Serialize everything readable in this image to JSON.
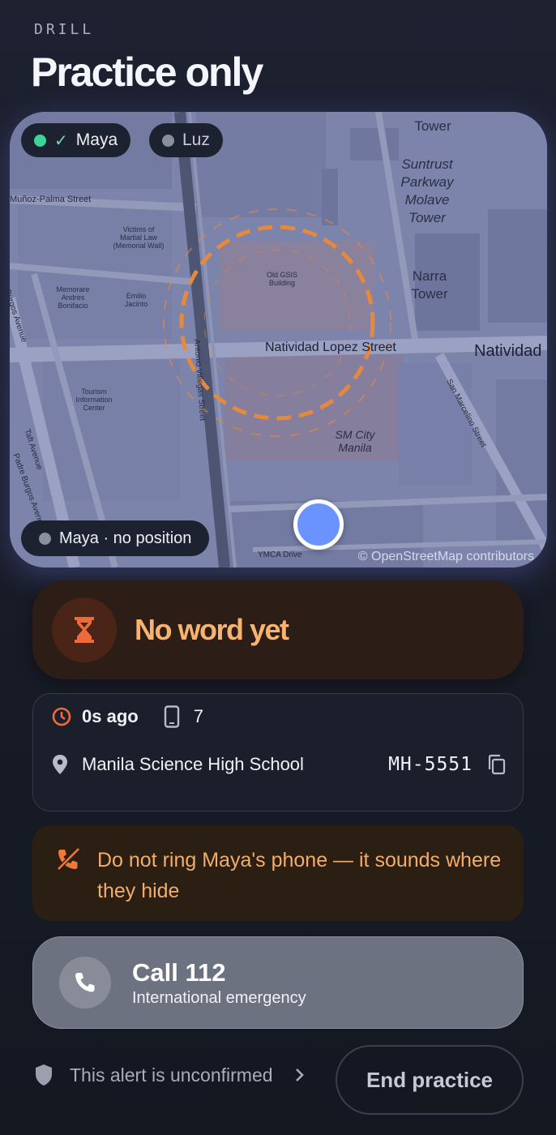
{
  "header": {
    "eyebrow": "DRILL",
    "title": "Practice only"
  },
  "map": {
    "chips": {
      "maya": {
        "label": "Maya",
        "dot_color": "#3fd39a",
        "confirmed": true
      },
      "luz": {
        "label": "Luz",
        "dot_color": "#8a8f9c"
      }
    },
    "no_position_label": "Maya · no position",
    "attribution": "© OpenStreetMap contributors",
    "labels": {
      "street1": "Natividad Lopez Street",
      "street2": "Natividad",
      "street3": "Muñoz-Palma Street",
      "street4": "Padre Burgos Avenue",
      "street5": "Taft Avenue",
      "street6": "Burgos Avenue",
      "street7": "San Marcelino Street",
      "street8": "Antonio Villegas Street",
      "street9": "YMCA Drive",
      "poi1": "Suntrust Parkway Molave Tower",
      "poi2": "Narra Tower",
      "poi3": "SM City Manila",
      "poi4": "Old GSIS Building",
      "poi5": "Victims of Martial Law (Memorial Wall)",
      "poi6": "Memorare Andres Bonifacio",
      "poi7": "Emilio Jacinto",
      "poi8": "Tourism Information Center",
      "poi9": "Tower"
    }
  },
  "status": {
    "text": "No word yet",
    "icon": "hourglass-icon",
    "color": "#f7b36f"
  },
  "info": {
    "time_ago": "0s ago",
    "device_count": "7",
    "location": "Manila Science High School",
    "code": "MH-5551"
  },
  "warning": {
    "text": "Do not ring Maya's phone — it sounds where they hide"
  },
  "call": {
    "title": "Call 112",
    "subtitle": "International emergency"
  },
  "footer": {
    "unconfirmed": "This alert is unconfirmed",
    "end_button": "End practice"
  }
}
